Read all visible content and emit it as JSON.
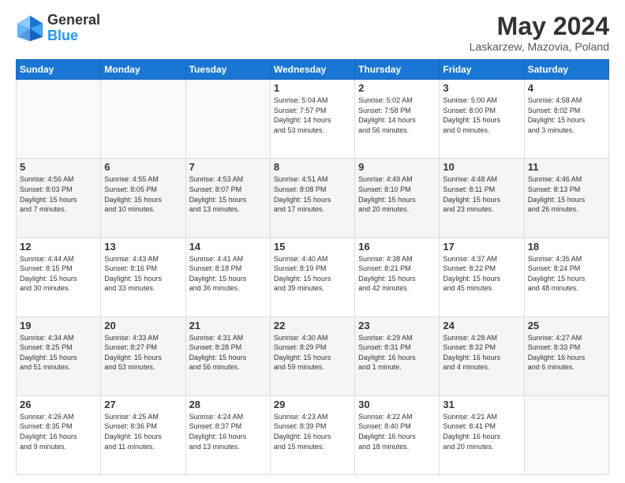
{
  "header": {
    "logo_general": "General",
    "logo_blue": "Blue",
    "title": "May 2024",
    "subtitle": "Laskarzew, Mazovia, Poland"
  },
  "days_of_week": [
    "Sunday",
    "Monday",
    "Tuesday",
    "Wednesday",
    "Thursday",
    "Friday",
    "Saturday"
  ],
  "weeks": [
    [
      {
        "day": "",
        "info": []
      },
      {
        "day": "",
        "info": []
      },
      {
        "day": "",
        "info": []
      },
      {
        "day": "1",
        "info": [
          "Sunrise: 5:04 AM",
          "Sunset: 7:57 PM",
          "Daylight: 14 hours",
          "and 53 minutes."
        ]
      },
      {
        "day": "2",
        "info": [
          "Sunrise: 5:02 AM",
          "Sunset: 7:58 PM",
          "Daylight: 14 hours",
          "and 56 minutes."
        ]
      },
      {
        "day": "3",
        "info": [
          "Sunrise: 5:00 AM",
          "Sunset: 8:00 PM",
          "Daylight: 15 hours",
          "and 0 minutes."
        ]
      },
      {
        "day": "4",
        "info": [
          "Sunrise: 4:58 AM",
          "Sunset: 8:02 PM",
          "Daylight: 15 hours",
          "and 3 minutes."
        ]
      }
    ],
    [
      {
        "day": "5",
        "info": [
          "Sunrise: 4:56 AM",
          "Sunset: 8:03 PM",
          "Daylight: 15 hours",
          "and 7 minutes."
        ]
      },
      {
        "day": "6",
        "info": [
          "Sunrise: 4:55 AM",
          "Sunset: 8:05 PM",
          "Daylight: 15 hours",
          "and 10 minutes."
        ]
      },
      {
        "day": "7",
        "info": [
          "Sunrise: 4:53 AM",
          "Sunset: 8:07 PM",
          "Daylight: 15 hours",
          "and 13 minutes."
        ]
      },
      {
        "day": "8",
        "info": [
          "Sunrise: 4:51 AM",
          "Sunset: 8:08 PM",
          "Daylight: 15 hours",
          "and 17 minutes."
        ]
      },
      {
        "day": "9",
        "info": [
          "Sunrise: 4:49 AM",
          "Sunset: 8:10 PM",
          "Daylight: 15 hours",
          "and 20 minutes."
        ]
      },
      {
        "day": "10",
        "info": [
          "Sunrise: 4:48 AM",
          "Sunset: 8:11 PM",
          "Daylight: 15 hours",
          "and 23 minutes."
        ]
      },
      {
        "day": "11",
        "info": [
          "Sunrise: 4:46 AM",
          "Sunset: 8:13 PM",
          "Daylight: 15 hours",
          "and 26 minutes."
        ]
      }
    ],
    [
      {
        "day": "12",
        "info": [
          "Sunrise: 4:44 AM",
          "Sunset: 8:15 PM",
          "Daylight: 15 hours",
          "and 30 minutes."
        ]
      },
      {
        "day": "13",
        "info": [
          "Sunrise: 4:43 AM",
          "Sunset: 8:16 PM",
          "Daylight: 15 hours",
          "and 33 minutes."
        ]
      },
      {
        "day": "14",
        "info": [
          "Sunrise: 4:41 AM",
          "Sunset: 8:18 PM",
          "Daylight: 15 hours",
          "and 36 minutes."
        ]
      },
      {
        "day": "15",
        "info": [
          "Sunrise: 4:40 AM",
          "Sunset: 8:19 PM",
          "Daylight: 15 hours",
          "and 39 minutes."
        ]
      },
      {
        "day": "16",
        "info": [
          "Sunrise: 4:38 AM",
          "Sunset: 8:21 PM",
          "Daylight: 15 hours",
          "and 42 minutes."
        ]
      },
      {
        "day": "17",
        "info": [
          "Sunrise: 4:37 AM",
          "Sunset: 8:22 PM",
          "Daylight: 15 hours",
          "and 45 minutes."
        ]
      },
      {
        "day": "18",
        "info": [
          "Sunrise: 4:35 AM",
          "Sunset: 8:24 PM",
          "Daylight: 15 hours",
          "and 48 minutes."
        ]
      }
    ],
    [
      {
        "day": "19",
        "info": [
          "Sunrise: 4:34 AM",
          "Sunset: 8:25 PM",
          "Daylight: 15 hours",
          "and 51 minutes."
        ]
      },
      {
        "day": "20",
        "info": [
          "Sunrise: 4:33 AM",
          "Sunset: 8:27 PM",
          "Daylight: 15 hours",
          "and 53 minutes."
        ]
      },
      {
        "day": "21",
        "info": [
          "Sunrise: 4:31 AM",
          "Sunset: 8:28 PM",
          "Daylight: 15 hours",
          "and 56 minutes."
        ]
      },
      {
        "day": "22",
        "info": [
          "Sunrise: 4:30 AM",
          "Sunset: 8:29 PM",
          "Daylight: 15 hours",
          "and 59 minutes."
        ]
      },
      {
        "day": "23",
        "info": [
          "Sunrise: 4:29 AM",
          "Sunset: 8:31 PM",
          "Daylight: 16 hours",
          "and 1 minute."
        ]
      },
      {
        "day": "24",
        "info": [
          "Sunrise: 4:28 AM",
          "Sunset: 8:32 PM",
          "Daylight: 16 hours",
          "and 4 minutes."
        ]
      },
      {
        "day": "25",
        "info": [
          "Sunrise: 4:27 AM",
          "Sunset: 8:33 PM",
          "Daylight: 16 hours",
          "and 6 minutes."
        ]
      }
    ],
    [
      {
        "day": "26",
        "info": [
          "Sunrise: 4:26 AM",
          "Sunset: 8:35 PM",
          "Daylight: 16 hours",
          "and 9 minutes."
        ]
      },
      {
        "day": "27",
        "info": [
          "Sunrise: 4:25 AM",
          "Sunset: 8:36 PM",
          "Daylight: 16 hours",
          "and 11 minutes."
        ]
      },
      {
        "day": "28",
        "info": [
          "Sunrise: 4:24 AM",
          "Sunset: 8:37 PM",
          "Daylight: 16 hours",
          "and 13 minutes."
        ]
      },
      {
        "day": "29",
        "info": [
          "Sunrise: 4:23 AM",
          "Sunset: 8:39 PM",
          "Daylight: 16 hours",
          "and 15 minutes."
        ]
      },
      {
        "day": "30",
        "info": [
          "Sunrise: 4:22 AM",
          "Sunset: 8:40 PM",
          "Daylight: 16 hours",
          "and 18 minutes."
        ]
      },
      {
        "day": "31",
        "info": [
          "Sunrise: 4:21 AM",
          "Sunset: 8:41 PM",
          "Daylight: 16 hours",
          "and 20 minutes."
        ]
      },
      {
        "day": "",
        "info": []
      }
    ]
  ],
  "colors": {
    "header_bg": "#1976D2",
    "accent": "#2196F3"
  }
}
